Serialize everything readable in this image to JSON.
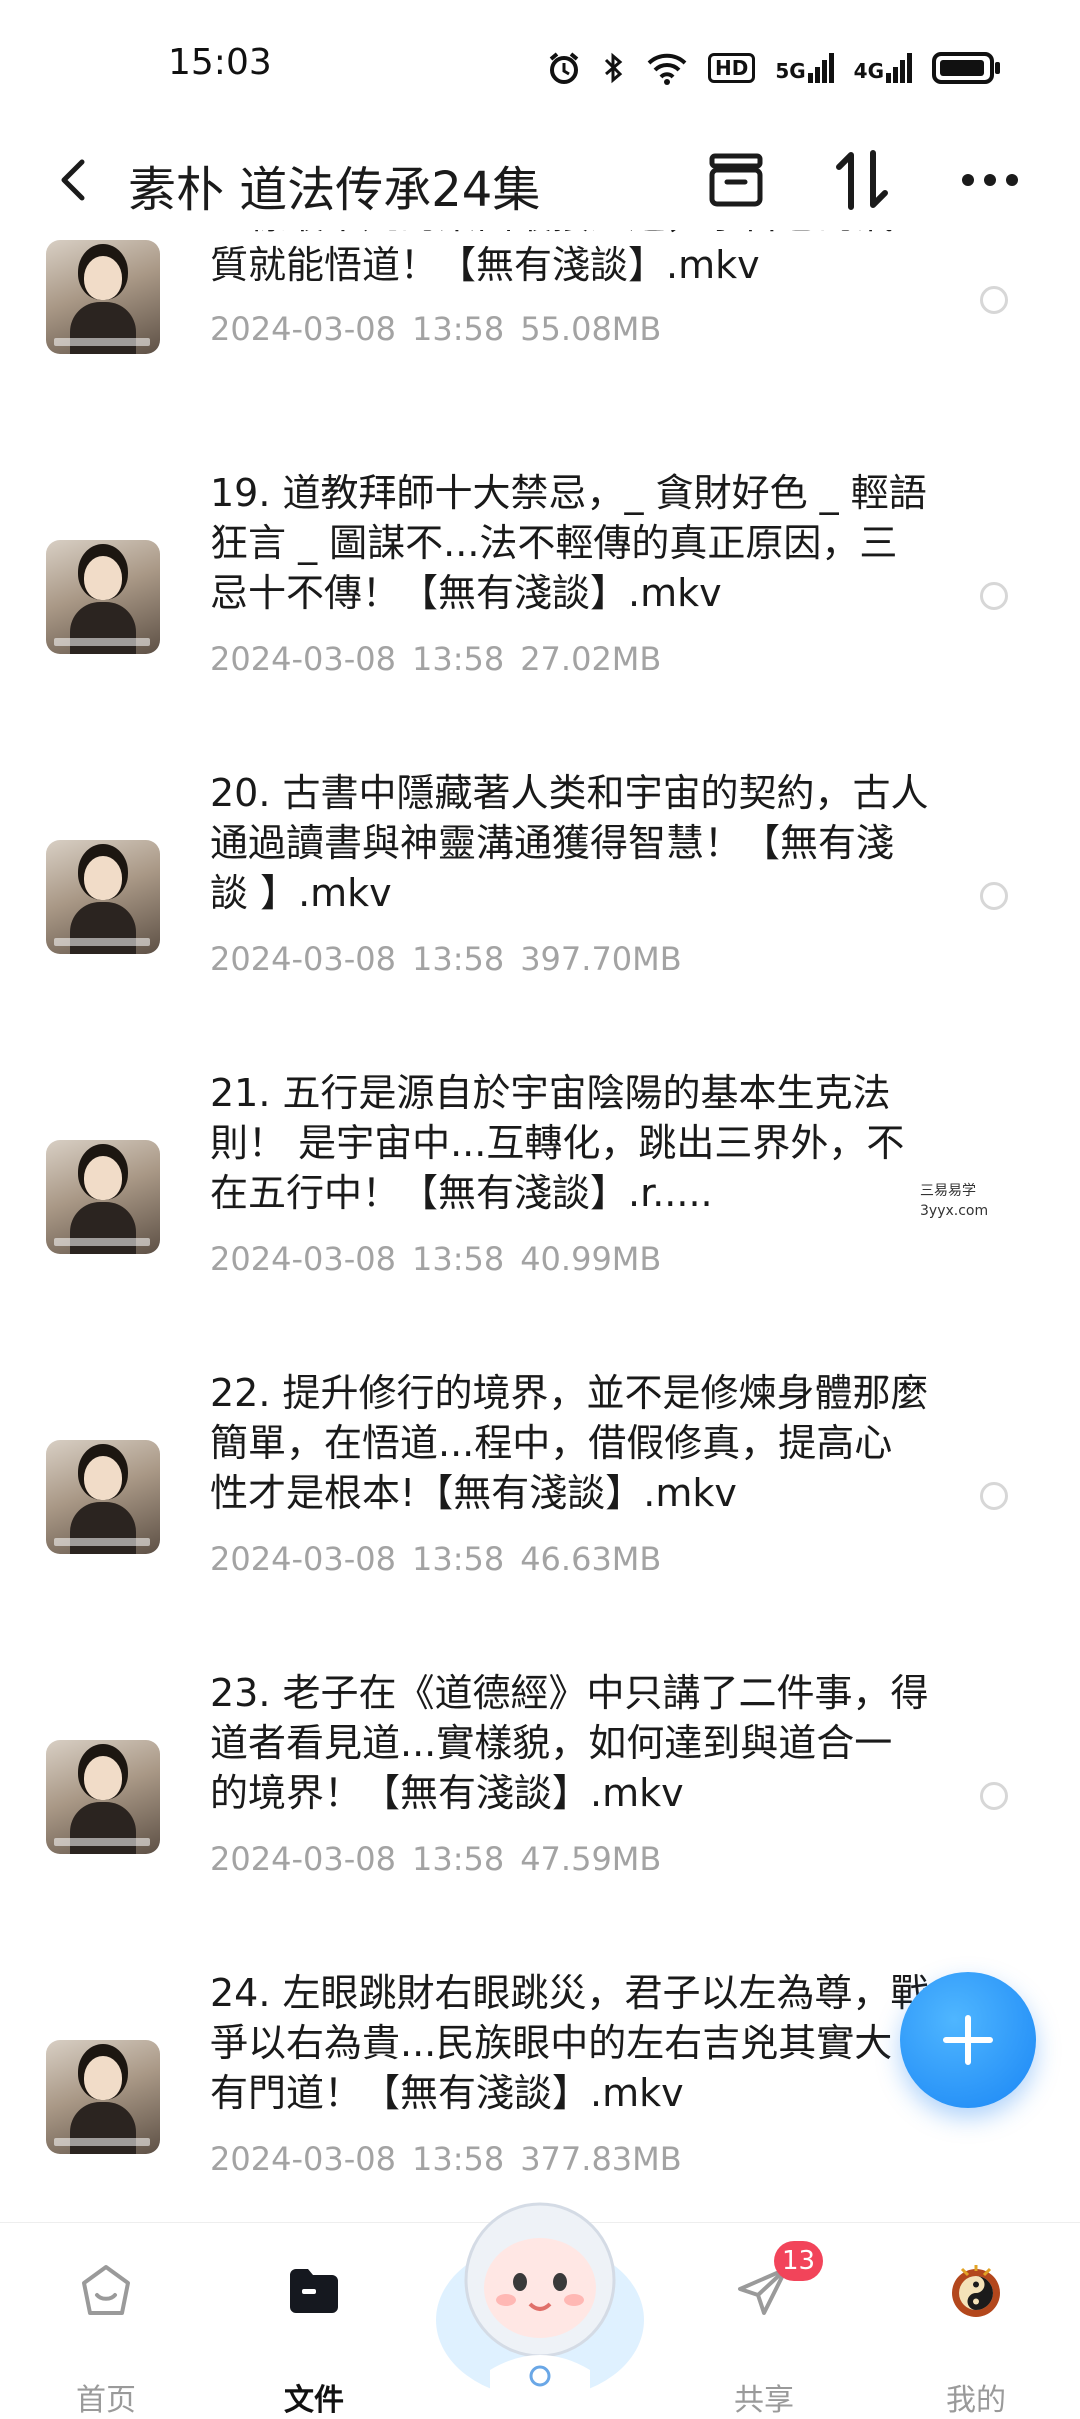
{
  "status": {
    "time": "15:03",
    "hd": "HD",
    "net1": "5G",
    "net2": "4G"
  },
  "header": {
    "title": "素朴 道法传承24集"
  },
  "files": [
    {
      "title": "一樣最平凡的東西最接近道，學習它的氣質就能悟道！【無有淺談】.mkv",
      "date": "2024-03-08",
      "time": "13:58",
      "size": "55.08MB"
    },
    {
      "title": "19. 道教拜師十大禁忌，_ 貪財好色 _ 輕語狂言 _ 圖謀不...法不輕傳的真正原因，三忌十不傳！【無有淺談】.mkv",
      "date": "2024-03-08",
      "time": "13:58",
      "size": "27.02MB"
    },
    {
      "title": "20. 古書中隱藏著人类和宇宙的契約，古人通過讀書與神靈溝通獲得智慧！【無有淺談 】.mkv",
      "date": "2024-03-08",
      "time": "13:58",
      "size": "397.70MB"
    },
    {
      "title": "21. 五行是源自於宇宙陰陽的基本生克法則！ 是宇宙中...互轉化，跳出三界外，不在五行中！【無有淺談】.r.....",
      "date": "2024-03-08",
      "time": "13:58",
      "size": "40.99MB"
    },
    {
      "title": "22. 提升修行的境界，並不是修煉身體那麼簡單，在悟道...程中，借假修真，提高心性才是根本!【無有淺談】.mkv",
      "date": "2024-03-08",
      "time": "13:58",
      "size": "46.63MB"
    },
    {
      "title": "23. 老子在《道德經》中只講了二件事，得道者看見道...實樣貌，如何達到與道合一的境界！【無有淺談】.mkv",
      "date": "2024-03-08",
      "time": "13:58",
      "size": "47.59MB"
    },
    {
      "title": "24. 左眼跳財右眼跳災，君子以左為尊，戰爭以右為貴...民族眼中的左右吉兇其實大有門道！【無有淺談】.mkv",
      "date": "2024-03-08",
      "time": "13:58",
      "size": "377.83MB"
    }
  ],
  "watermark": {
    "line1": "三易易学",
    "line2": "3yyx.com"
  },
  "nav": {
    "home": "首页",
    "files": "文件",
    "share": "共享",
    "share_badge": "13",
    "mine": "我的"
  },
  "colors": {
    "accent": "#1a86f5",
    "badge": "#f2445a",
    "meta": "#a3a3a3"
  }
}
